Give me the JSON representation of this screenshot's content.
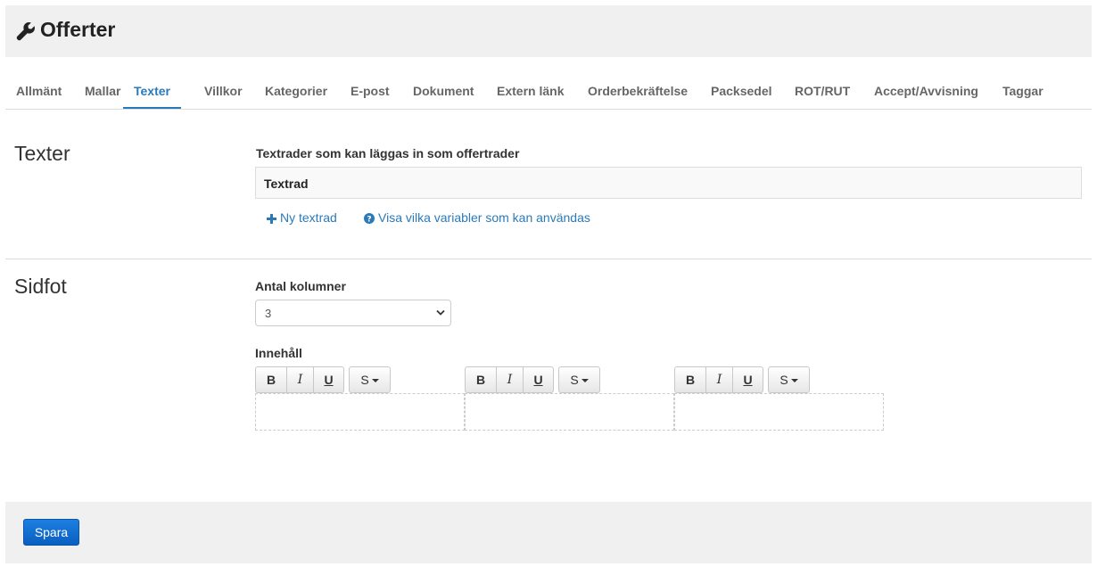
{
  "header": {
    "title": "Offerter",
    "icon": "wrench-icon"
  },
  "tabs": [
    {
      "label": "Allmänt",
      "active": false
    },
    {
      "label": "Mallar",
      "active": false
    },
    {
      "label": "Texter",
      "active": true
    },
    {
      "label": "Villkor",
      "active": false
    },
    {
      "label": "Kategorier",
      "active": false
    },
    {
      "label": "E-post",
      "active": false
    },
    {
      "label": "Dokument",
      "active": false
    },
    {
      "label": "Extern länk",
      "active": false
    },
    {
      "label": "Orderbekräftelse",
      "active": false
    },
    {
      "label": "Packsedel",
      "active": false
    },
    {
      "label": "ROT/RUT",
      "active": false
    },
    {
      "label": "Accept/Avvisning",
      "active": false
    },
    {
      "label": "Taggar",
      "active": false
    }
  ],
  "texter": {
    "title": "Texter",
    "label": "Textrader som kan läggas in som offertrader",
    "table_header": "Textrad",
    "new_link": "Ny textrad",
    "variables_link": "Visa vilka variabler som kan användas"
  },
  "sidfot": {
    "title": "Sidfot",
    "columns_label": "Antal kolumner",
    "columns_value": "3",
    "content_label": "Innehåll",
    "editor_buttons": {
      "bold": "B",
      "italic": "I",
      "underline": "U",
      "style": "S"
    }
  },
  "footer": {
    "save_label": "Spara"
  },
  "colors": {
    "accent": "#2a7ab8",
    "save_button": "#0a66cc",
    "panel_bg": "#f0f0f0"
  }
}
